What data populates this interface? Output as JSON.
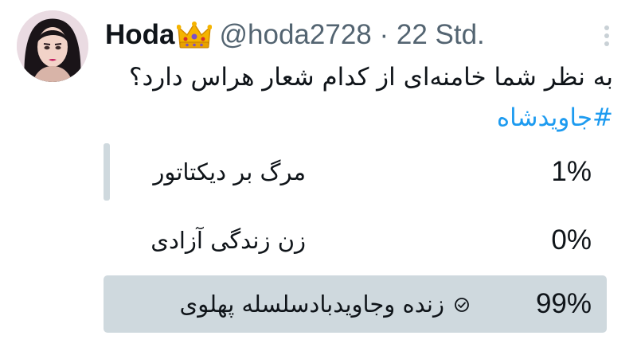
{
  "tweet": {
    "display_name": "Hoda",
    "badge_icon": "crown-emoji",
    "handle_time": "@hoda2728 · 22 Std.",
    "text": "به نظر شما خامنه‌ای از کدام شعار هراس دارد؟",
    "hashtag": "#جاویدشاه"
  },
  "poll": {
    "options": [
      {
        "label": "مرگ بر دیکتاتور",
        "percent_label": "1%",
        "percent": 1,
        "selected": false
      },
      {
        "label": "زن زندگی آزادی",
        "percent_label": "0%",
        "percent": 0,
        "selected": false
      },
      {
        "label": "زنده وجاویدبادسلسله پهلوی",
        "percent_label": "99%",
        "percent": 99,
        "selected": true
      }
    ]
  },
  "colors": {
    "text": "#0f1419",
    "secondary": "#536471",
    "link": "#1d9bf0",
    "poll_bar": "#cfd9de"
  },
  "icons": {
    "menu": "more-vertical-icon",
    "selected": "check-circle-icon"
  }
}
